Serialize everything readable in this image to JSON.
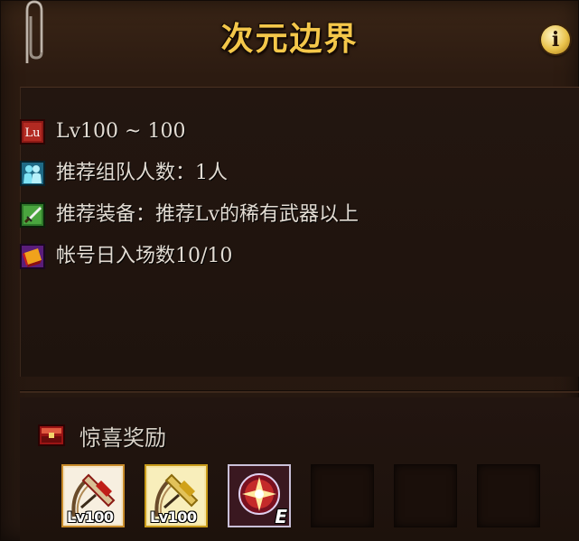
{
  "window": {
    "title": "次元边界",
    "info_label": "i"
  },
  "requirements": [
    {
      "icon": "level-icon",
      "icon_text": "Lu",
      "text": "Lv100 ~ 100"
    },
    {
      "icon": "party-icon",
      "text": "推荐组队人数：1人"
    },
    {
      "icon": "sword-icon",
      "text": "推荐装备：推荐Lv的稀有武器以上"
    },
    {
      "icon": "ticket-icon",
      "text": "帐号日入场数10/10"
    }
  ],
  "rewards": {
    "title": "惊喜奖励",
    "slots": [
      {
        "type": "weapon",
        "level": "Lv100"
      },
      {
        "type": "weapon",
        "level": "Lv100"
      },
      {
        "type": "orb",
        "grade": "E"
      },
      {
        "type": "empty"
      },
      {
        "type": "empty"
      },
      {
        "type": "empty"
      }
    ]
  },
  "colors": {
    "title": "#f4c74a",
    "text": "#e3dcd3",
    "background": "#241710"
  }
}
